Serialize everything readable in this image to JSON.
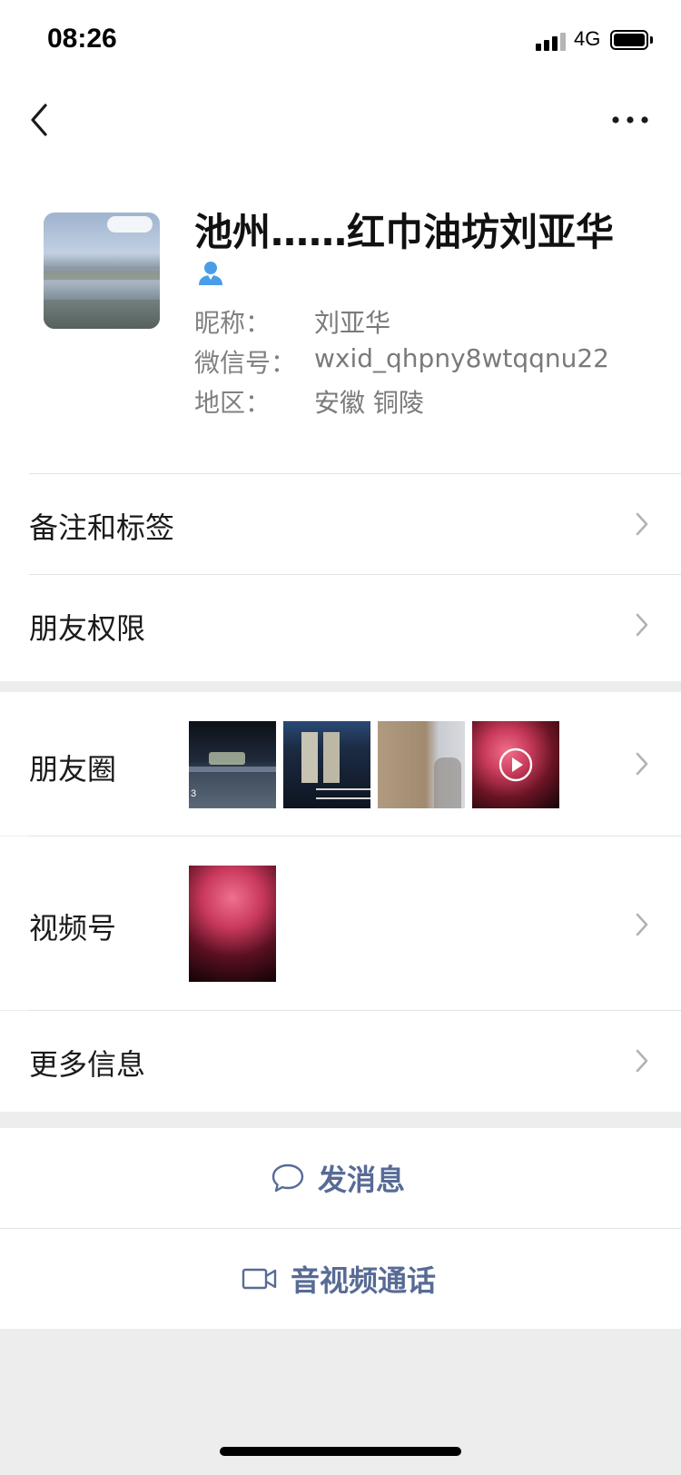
{
  "status_bar": {
    "time": "08:26",
    "network": "4G"
  },
  "nav": {
    "back_icon": "chevron-left-icon",
    "more_icon": "more-dots-icon"
  },
  "profile": {
    "name": "池州……红巾油坊刘亚华",
    "contact_icon": "person-icon",
    "nickname_label": "昵称：",
    "nickname_value": "刘亚华",
    "wechat_id_label": "微信号：",
    "wechat_id_value": "wxid_qhpny8wtqqnu22",
    "region_label": "地区：",
    "region_value": "安徽 铜陵"
  },
  "menu": {
    "remarks_tags": "备注和标签",
    "friend_permissions": "朋友权限",
    "moments": "朋友圈",
    "channels": "视频号",
    "more_info": "更多信息"
  },
  "moments_thumbnails": [
    {
      "desc": "night-street-photo",
      "caption": "3"
    },
    {
      "desc": "building-entrance-photo"
    },
    {
      "desc": "wall-tree-photo"
    },
    {
      "desc": "red-smoke-video",
      "has_play": true
    }
  ],
  "actions": {
    "send_message": "发消息",
    "video_call": "音视频通话"
  },
  "colors": {
    "accent_link": "#576b95",
    "contact_icon": "#4a9ee8",
    "background": "#ededed"
  }
}
